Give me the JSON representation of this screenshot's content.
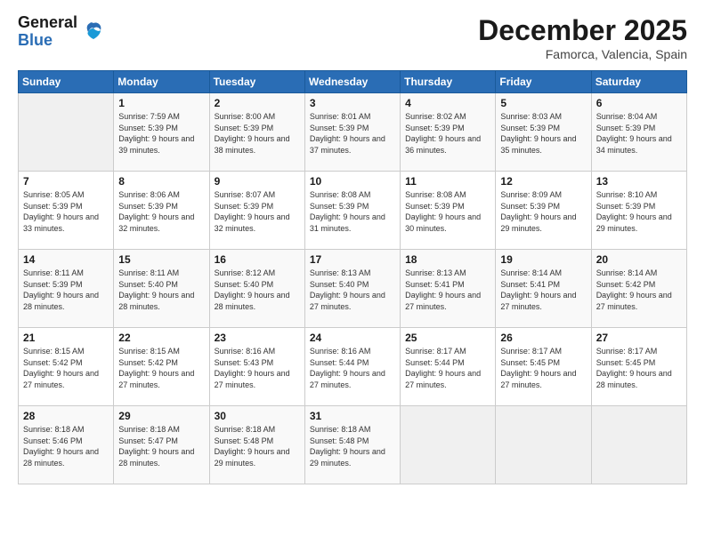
{
  "header": {
    "logo": {
      "line1": "General",
      "line2": "Blue"
    },
    "title": "December 2025",
    "location": "Famorca, Valencia, Spain"
  },
  "days_of_week": [
    "Sunday",
    "Monday",
    "Tuesday",
    "Wednesday",
    "Thursday",
    "Friday",
    "Saturday"
  ],
  "weeks": [
    [
      null,
      {
        "day": "1",
        "sunrise": "7:59 AM",
        "sunset": "5:39 PM",
        "daylight": "9 hours and 39 minutes."
      },
      {
        "day": "2",
        "sunrise": "8:00 AM",
        "sunset": "5:39 PM",
        "daylight": "9 hours and 38 minutes."
      },
      {
        "day": "3",
        "sunrise": "8:01 AM",
        "sunset": "5:39 PM",
        "daylight": "9 hours and 37 minutes."
      },
      {
        "day": "4",
        "sunrise": "8:02 AM",
        "sunset": "5:39 PM",
        "daylight": "9 hours and 36 minutes."
      },
      {
        "day": "5",
        "sunrise": "8:03 AM",
        "sunset": "5:39 PM",
        "daylight": "9 hours and 35 minutes."
      },
      {
        "day": "6",
        "sunrise": "8:04 AM",
        "sunset": "5:39 PM",
        "daylight": "9 hours and 34 minutes."
      }
    ],
    [
      {
        "day": "7",
        "sunrise": "8:05 AM",
        "sunset": "5:39 PM",
        "daylight": "9 hours and 33 minutes."
      },
      {
        "day": "8",
        "sunrise": "8:06 AM",
        "sunset": "5:39 PM",
        "daylight": "9 hours and 32 minutes."
      },
      {
        "day": "9",
        "sunrise": "8:07 AM",
        "sunset": "5:39 PM",
        "daylight": "9 hours and 32 minutes."
      },
      {
        "day": "10",
        "sunrise": "8:08 AM",
        "sunset": "5:39 PM",
        "daylight": "9 hours and 31 minutes."
      },
      {
        "day": "11",
        "sunrise": "8:08 AM",
        "sunset": "5:39 PM",
        "daylight": "9 hours and 30 minutes."
      },
      {
        "day": "12",
        "sunrise": "8:09 AM",
        "sunset": "5:39 PM",
        "daylight": "9 hours and 29 minutes."
      },
      {
        "day": "13",
        "sunrise": "8:10 AM",
        "sunset": "5:39 PM",
        "daylight": "9 hours and 29 minutes."
      }
    ],
    [
      {
        "day": "14",
        "sunrise": "8:11 AM",
        "sunset": "5:39 PM",
        "daylight": "9 hours and 28 minutes."
      },
      {
        "day": "15",
        "sunrise": "8:11 AM",
        "sunset": "5:40 PM",
        "daylight": "9 hours and 28 minutes."
      },
      {
        "day": "16",
        "sunrise": "8:12 AM",
        "sunset": "5:40 PM",
        "daylight": "9 hours and 28 minutes."
      },
      {
        "day": "17",
        "sunrise": "8:13 AM",
        "sunset": "5:40 PM",
        "daylight": "9 hours and 27 minutes."
      },
      {
        "day": "18",
        "sunrise": "8:13 AM",
        "sunset": "5:41 PM",
        "daylight": "9 hours and 27 minutes."
      },
      {
        "day": "19",
        "sunrise": "8:14 AM",
        "sunset": "5:41 PM",
        "daylight": "9 hours and 27 minutes."
      },
      {
        "day": "20",
        "sunrise": "8:14 AM",
        "sunset": "5:42 PM",
        "daylight": "9 hours and 27 minutes."
      }
    ],
    [
      {
        "day": "21",
        "sunrise": "8:15 AM",
        "sunset": "5:42 PM",
        "daylight": "9 hours and 27 minutes."
      },
      {
        "day": "22",
        "sunrise": "8:15 AM",
        "sunset": "5:42 PM",
        "daylight": "9 hours and 27 minutes."
      },
      {
        "day": "23",
        "sunrise": "8:16 AM",
        "sunset": "5:43 PM",
        "daylight": "9 hours and 27 minutes."
      },
      {
        "day": "24",
        "sunrise": "8:16 AM",
        "sunset": "5:44 PM",
        "daylight": "9 hours and 27 minutes."
      },
      {
        "day": "25",
        "sunrise": "8:17 AM",
        "sunset": "5:44 PM",
        "daylight": "9 hours and 27 minutes."
      },
      {
        "day": "26",
        "sunrise": "8:17 AM",
        "sunset": "5:45 PM",
        "daylight": "9 hours and 27 minutes."
      },
      {
        "day": "27",
        "sunrise": "8:17 AM",
        "sunset": "5:45 PM",
        "daylight": "9 hours and 28 minutes."
      }
    ],
    [
      {
        "day": "28",
        "sunrise": "8:18 AM",
        "sunset": "5:46 PM",
        "daylight": "9 hours and 28 minutes."
      },
      {
        "day": "29",
        "sunrise": "8:18 AM",
        "sunset": "5:47 PM",
        "daylight": "9 hours and 28 minutes."
      },
      {
        "day": "30",
        "sunrise": "8:18 AM",
        "sunset": "5:48 PM",
        "daylight": "9 hours and 29 minutes."
      },
      {
        "day": "31",
        "sunrise": "8:18 AM",
        "sunset": "5:48 PM",
        "daylight": "9 hours and 29 minutes."
      },
      null,
      null,
      null
    ]
  ],
  "labels": {
    "sunrise": "Sunrise:",
    "sunset": "Sunset:",
    "daylight": "Daylight:"
  }
}
